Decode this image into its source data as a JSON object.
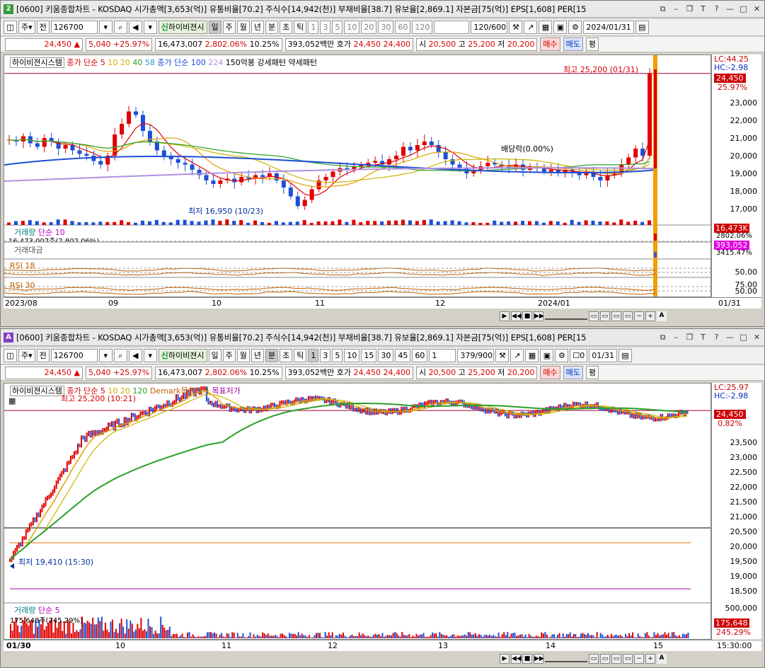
{
  "window1": {
    "num": "2",
    "title": "[0600] 키움종합차트 - KOSDAQ 시가총액[3,653(억)] 유통비율[70.2] 주식수[14,942(천)] 부채비율[38.7] 유보율[2,869.1] 자본금[75(억)] EPS[1,608] PER[15",
    "toolbar": {
      "ju": "주",
      "jeon": "전",
      "code": "126700",
      "name": "하이비젼시",
      "periods": [
        "일",
        "주",
        "월",
        "년",
        "분",
        "초",
        "틱"
      ],
      "active_period": "일",
      "nums": [
        "1",
        "3",
        "5",
        "10",
        "20",
        "30",
        "60",
        "120"
      ],
      "count": "120/600",
      "date": "2024/01/31"
    },
    "quote": {
      "price": "24,450",
      "arrow": "▲",
      "change": "5,040",
      "pct": "+25.97%",
      "volume": "16,473,007",
      "vol_pct": "2,802.06%",
      "turnover": "10.25%",
      "amount": "393,052백만",
      "hoga_label": "호가",
      "ask": "24,450",
      "bid": "24,400",
      "open_label": "시",
      "open": "20,500",
      "high_label": "고",
      "high": "25,200",
      "low_label": "저",
      "low": "20,200",
      "buy": "매수",
      "sell": "매도",
      "avg": "평"
    },
    "legend": {
      "system": "하이비젼시스템",
      "ma_label": "종가 단순 5",
      "ma10": "10",
      "ma20": "20",
      "ma40": "40",
      "ma58": "58",
      "ma2_label": "종가 단순 100",
      "ma224": "224",
      "pattern": "150억봉 강세패턴  약세패턴"
    },
    "annotations": {
      "high": "최고 25,200 (01/31)",
      "low": "최저 16,950 (10/23)",
      "dividend": "배당락(0.00%)"
    },
    "scale": {
      "lc": "LC:44.25",
      "hc": "HC:-2.98",
      "cur": "24,450",
      "cur_pct": "25.97%",
      "ticks": [
        "23,000",
        "22,000",
        "21,000",
        "20,000",
        "19,000",
        "18,000",
        "17,000"
      ]
    },
    "volume": {
      "label": "거래량",
      "ma": "단순 10",
      "value": "16,473,007주(2,802.06%)",
      "tag": "16,473K",
      "tag_pct": "2802.06%"
    },
    "amount_panel": {
      "label": "거래대금",
      "tag": "393,052",
      "tag_pct": "3415.47%"
    },
    "rsi18": {
      "label": "RSI 18",
      "tick": "50.00"
    },
    "rsi30": {
      "label": "RSI 30",
      "ticks": [
        "75.00",
        "50.00"
      ]
    },
    "xaxis": [
      "2023/08",
      "09",
      "10",
      "11",
      "12",
      "2024/01"
    ],
    "xaxis_right": "01/31"
  },
  "window2": {
    "num": "A",
    "title": "[0600] 키움종합차트 - KOSDAQ 시가총액[3,653(억)] 유통비율[70.2] 주식수[14,942(천)] 부채비율[38.7] 유보율[2,869.1] 자본금[75(억)] EPS[1,608] PER[15",
    "toolbar": {
      "ju": "주",
      "jeon": "전",
      "code": "126700",
      "name": "하이비젼시",
      "periods": [
        "일",
        "주",
        "월",
        "년",
        "분",
        "초",
        "틱"
      ],
      "active_period": "분",
      "nums": [
        "1",
        "3",
        "5",
        "10",
        "15",
        "30",
        "45",
        "60"
      ],
      "sel_num": "1",
      "count": "379/900",
      "check": "0",
      "date": "01/31"
    },
    "quote": {
      "price": "24,450",
      "arrow": "▲",
      "change": "5,040",
      "pct": "+25.97%",
      "volume": "16,473,007",
      "vol_pct": "2,802.06%",
      "turnover": "10.25%",
      "amount": "393,052백만",
      "hoga_label": "호가",
      "ask": "24,450",
      "bid": "24,400",
      "open_label": "시",
      "open": "20,500",
      "high_label": "고",
      "high": "25,200",
      "low_label": "저",
      "low": "20,200",
      "buy": "매수",
      "sell": "매도",
      "avg": "평"
    },
    "legend": {
      "system": "하이비젼시스템",
      "ma_label": "종가 단순 5",
      "ma10": "10",
      "ma20": "20",
      "ma120": "120",
      "demark_high": "Demark목표고가",
      "demark_low": "목표저가"
    },
    "annotations": {
      "high": "최고 25,200 (10:21)",
      "low": "최저 19,410 (15:30)"
    },
    "scale": {
      "lc": "LC:25.97",
      "hc": "HC:-2.98",
      "cur": "24,450",
      "cur_pct": "0.82%",
      "ticks": [
        "24,000",
        "23,500",
        "23,000",
        "22,500",
        "22,000",
        "21,500",
        "21,000",
        "20,500",
        "20,000",
        "19,500",
        "19,000",
        "18,500"
      ]
    },
    "volume": {
      "label": "거래량",
      "ma": "단순 5",
      "value": "175,648주(245.29%)",
      "tick": "500,000",
      "tag": "175,648",
      "tag_pct": "245.29%"
    },
    "xaxis": [
      "01/30",
      "10",
      "11",
      "12",
      "13",
      "14",
      "15"
    ],
    "xaxis_right": "15:30:00"
  },
  "colors": {
    "up": "#e00000",
    "down": "#1c4fd6",
    "accent": "#f0a000"
  }
}
